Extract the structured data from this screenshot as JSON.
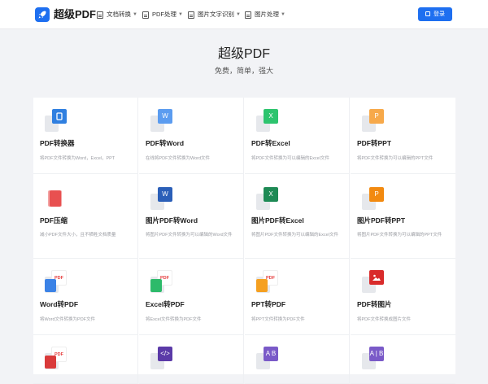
{
  "header": {
    "brand": "超级PDF",
    "nav": [
      {
        "label": "文档转换"
      },
      {
        "label": "PDF处理"
      },
      {
        "label": "图片文字识别"
      },
      {
        "label": "图片处理"
      }
    ],
    "login_label": "登录"
  },
  "hero": {
    "title": "超级PDF",
    "subtitle": "免费，简单，强大"
  },
  "colors": {
    "accent": "#1e6ff0",
    "word": "#2f6fd6",
    "excel": "#21a366",
    "ppt": "#f29b1d",
    "pdf": "#e64040"
  },
  "tools": [
    {
      "name": "PDF转换器",
      "desc": "将PDF文件转换为Word，Excel，PPT",
      "icon": "office-convert-icon",
      "letter": "",
      "color": "#2f7fe0"
    },
    {
      "name": "PDF转Word",
      "desc": "在线将PDF文件转换为Word文件",
      "icon": "word-icon",
      "letter": "W",
      "color": "#5b9cf0"
    },
    {
      "name": "PDF转Excel",
      "desc": "将PDF文件转换为可以编辑的Excel文件",
      "icon": "excel-icon",
      "letter": "X",
      "color": "#2dc46e"
    },
    {
      "name": "PDF转PPT",
      "desc": "将PDF文件转换为可以编辑的PPT文件",
      "icon": "ppt-icon",
      "letter": "P",
      "color": "#f7a94a"
    },
    {
      "name": "PDF压缩",
      "desc": "减小PDF文件大小，且不牺牲文档质量",
      "icon": "compress-icon",
      "letter": "",
      "color": "#e85050"
    },
    {
      "name": "图片PDF转Word",
      "desc": "将图片PDF文件转换为可以编辑的Word文件",
      "icon": "word-icon",
      "letter": "W",
      "color": "#2b5fb8"
    },
    {
      "name": "图片PDF转Excel",
      "desc": "将图片PDF文件转换为可以编辑的Excel文件",
      "icon": "excel-icon",
      "letter": "X",
      "color": "#1e8a55"
    },
    {
      "name": "图片PDF转PPT",
      "desc": "将图片PDF文件转换为可以编辑的PPT文件",
      "icon": "ppt-icon",
      "letter": "P",
      "color": "#f28a10"
    },
    {
      "name": "Word转PDF",
      "desc": "将Word文件转换为PDF文件",
      "icon": "word-to-pdf-icon",
      "letter": "PDF",
      "color": "#3b82e6"
    },
    {
      "name": "Excel转PDF",
      "desc": "将Excel文件转换为PDF文件",
      "icon": "excel-to-pdf-icon",
      "letter": "PDF",
      "color": "#2dba6a"
    },
    {
      "name": "PPT转PDF",
      "desc": "将PPT文件转换为PDF文件",
      "icon": "ppt-to-pdf-icon",
      "letter": "PDF",
      "color": "#f5a020"
    },
    {
      "name": "PDF转图片",
      "desc": "将PDF文件转换成图片文件",
      "icon": "pdf-to-image-icon",
      "letter": "",
      "color": "#d92b2b"
    },
    {
      "name": "",
      "desc": "",
      "icon": "image-to-pdf-icon",
      "letter": "PDF",
      "color": "#d93a3a"
    },
    {
      "name": "",
      "desc": "",
      "icon": "code-icon",
      "letter": "</>",
      "color": "#5b3aa8"
    },
    {
      "name": "",
      "desc": "",
      "icon": "ab-compare-icon",
      "letter": "A B",
      "color": "#7a5ac8"
    },
    {
      "name": "",
      "desc": "",
      "icon": "ab-split-icon",
      "letter": "A | B",
      "color": "#7a5ac8"
    }
  ]
}
